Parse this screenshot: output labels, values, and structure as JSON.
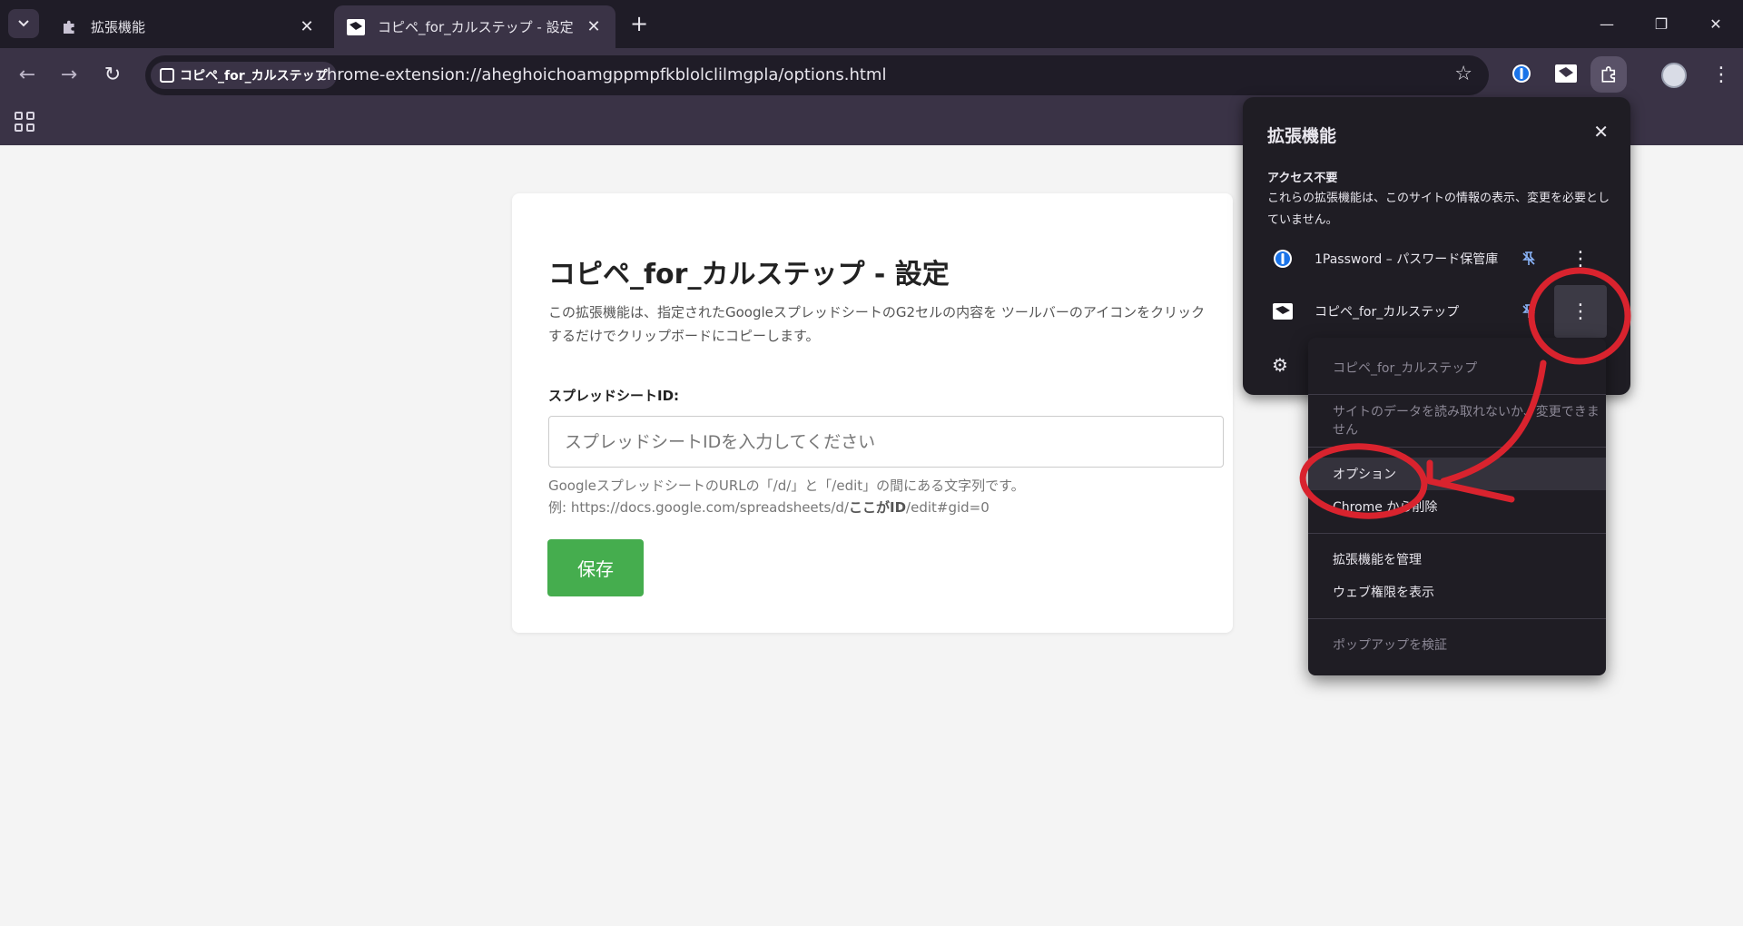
{
  "tabs": [
    {
      "label": "拡張機能",
      "icon": "puzzle-icon",
      "active": false
    },
    {
      "label": "コピペ_for_カルステップ - 設定",
      "icon": "extension-logo-icon",
      "active": true
    }
  ],
  "toolbar": {
    "chip_label": "コピペ_for_カルステップ",
    "url": "chrome-extension://aheghoichoamgppmpfkblolclilmgpla/options.html"
  },
  "page": {
    "title": "コピペ_for_カルステップ - 設定",
    "description": "この拡張機能は、指定されたGoogleスプレッドシートのG2セルの内容を ツールバーのアイコンをクリックするだけでクリップボードにコピーします。",
    "field_label": "スプレッドシートID:",
    "input_placeholder": "スプレッドシートIDを入力してください",
    "help_line1": "GoogleスプレッドシートのURLの「/d/」と「/edit」の間にある文字列です。",
    "help_line2_prefix": "例: https://docs.google.com/spreadsheets/d/",
    "help_line2_bold": "ここがID",
    "help_line2_suffix": "/edit#gid=0",
    "save_label": "保存"
  },
  "ext_panel": {
    "title": "拡張機能",
    "section_title": "アクセス不要",
    "section_desc": "これらの拡張機能は、このサイトの情報の表示、変更を必要としていません。",
    "items": [
      {
        "name": "1Password – パスワード保管庫",
        "icon": "1password-icon"
      },
      {
        "name": "コピペ_for_カルステップ",
        "icon": "extension-logo-icon"
      }
    ]
  },
  "context_menu": {
    "header": "コピペ_for_カルステップ",
    "site_access": "サイトのデータを読み取れないか、変更できません",
    "options": "オプション",
    "remove": "Chrome から削除",
    "manage": "拡張機能を管理",
    "web_perms": "ウェブ権限を表示",
    "inspect": "ポップアップを検証"
  },
  "annotation_color": "#d9232e"
}
